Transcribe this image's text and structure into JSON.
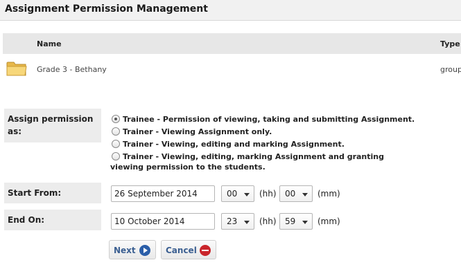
{
  "page": {
    "title": "Assignment Permission Management"
  },
  "group_table": {
    "columns": [
      "Name",
      "Type"
    ],
    "rows": [
      {
        "icon": "folder-icon",
        "name": "Grade 3 - Bethany",
        "type": "group"
      }
    ]
  },
  "form": {
    "assign_label": "Assign permission as:",
    "options": [
      {
        "label": "Trainee - Permission of viewing, taking and submitting Assignment.",
        "selected": true
      },
      {
        "label": "Trainer - Viewing Assignment only.",
        "selected": false
      },
      {
        "label": "Trainer - Viewing, editing and marking Assignment.",
        "selected": false
      },
      {
        "label": "Trainer - Viewing, editing, marking Assignment and granting viewing permission to the students.",
        "selected": false
      }
    ],
    "start": {
      "label": "Start From:",
      "date": "26 September 2014",
      "hour": "00",
      "minute": "00"
    },
    "end": {
      "label": "End On:",
      "date": "10 October 2014",
      "hour": "23",
      "minute": "59"
    },
    "hh_unit": "(hh)",
    "mm_unit": "(mm)"
  },
  "buttons": {
    "next": {
      "label": "Next",
      "icon": "arrow-right-icon",
      "color": "#2b5ea8"
    },
    "cancel": {
      "label": "Cancel",
      "icon": "minus-circle-icon",
      "color": "#c9252b"
    }
  }
}
